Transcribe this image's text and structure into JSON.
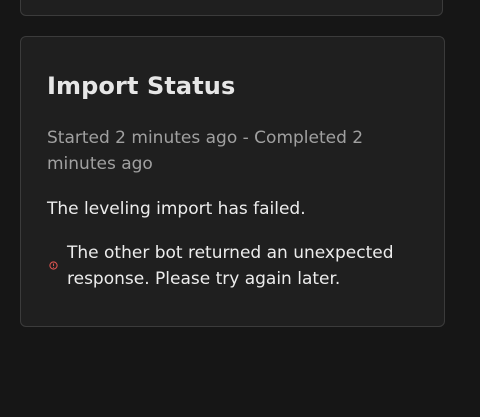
{
  "import_status": {
    "title": "Import Status",
    "timing": "Started 2 minutes ago - Completed 2 minutes ago",
    "message": "The leveling import has failed.",
    "error": {
      "icon": "error-circle-icon",
      "text": "The other bot returned an unexpected response. Please try again later.",
      "color": "#d9534f"
    }
  },
  "theme": {
    "background": "#161616",
    "card": "#1f1f1f",
    "border": "#3b3b3b"
  }
}
